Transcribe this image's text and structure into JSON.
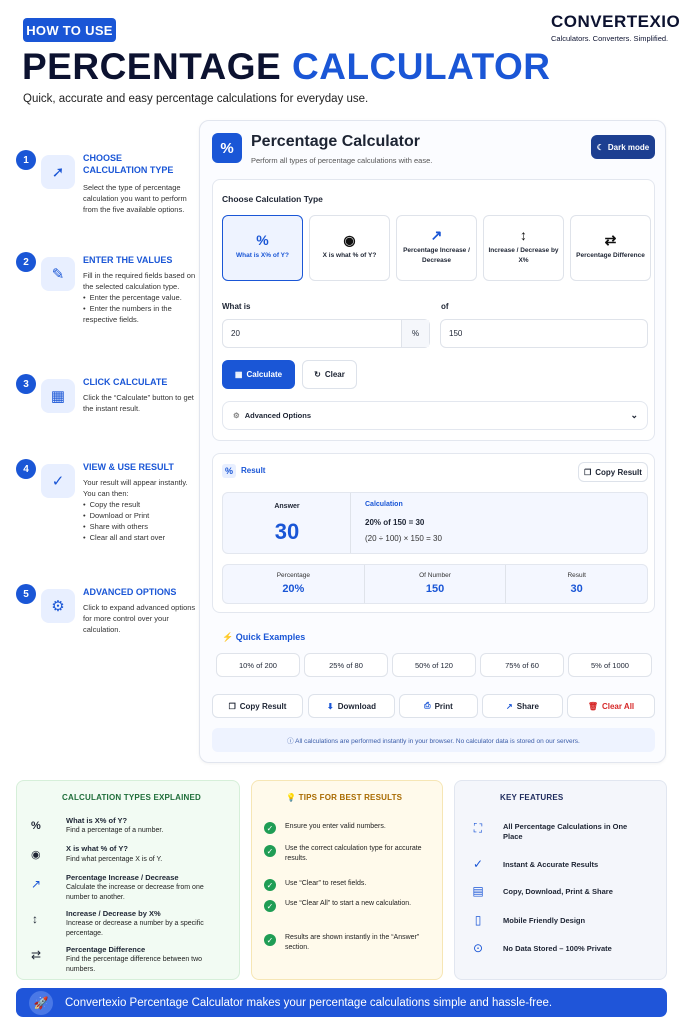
{
  "header": {
    "badge": "HOW TO USE",
    "title_main": "PERCENTAGE",
    "title_accent": "CALCULATOR",
    "subtitle": "Quick, accurate and easy percentage calculations for everyday use.",
    "brand": "CONVERTEXIO",
    "brand_tagline": "Calculators. Converters. Simplified."
  },
  "steps": [
    {
      "num": "1",
      "title_line1": "CHOOSE",
      "title_line2": "CALCULATION TYPE",
      "text": "Select the type of percentage calculation you want to perform from the five available options.",
      "bullets": []
    },
    {
      "num": "2",
      "title_line1": "ENTER THE VALUES",
      "title_line2": "",
      "text": "Fill in the required fields based on the selected calculation type.",
      "bullets": [
        "Enter the percentage value.",
        "Enter the numbers in the respective fields."
      ]
    },
    {
      "num": "3",
      "title_line1": "CLICK CALCULATE",
      "title_line2": "",
      "text": "Click the “Calculate” button to get the instant result.",
      "bullets": []
    },
    {
      "num": "4",
      "title_line1": "VIEW & USE RESULT",
      "title_line2": "",
      "text": "Your result will appear instantly. You can then:",
      "bullets": [
        "Copy the result",
        "Download or Print",
        "Share with others",
        "Clear all and start over"
      ]
    },
    {
      "num": "5",
      "title_line1": "ADVANCED OPTIONS",
      "title_line2": "",
      "text": "Click to expand advanced options for more control over your calculation.",
      "bullets": []
    }
  ],
  "calc": {
    "icon": "%",
    "title": "Percentage Calculator",
    "subtitle": "Perform all types of percentage calculations with ease.",
    "dark_mode": "Dark mode",
    "choose_label": "Choose Calculation Type",
    "types": [
      {
        "icon": "%",
        "label": "What is X% of Y?"
      },
      {
        "icon": "◉",
        "label": "X is what % of Y?"
      },
      {
        "icon": "↗",
        "label": "Percentage Increase / Decrease"
      },
      {
        "icon": "↕",
        "label": "Increase / Decrease by X%"
      },
      {
        "icon": "⇄",
        "label": "Percentage Difference"
      }
    ],
    "field1_label": "What is",
    "field1_value": "20",
    "field1_suffix": "%",
    "field2_label": "of",
    "field2_value": "150",
    "calculate": "Calculate",
    "clear": "Clear",
    "advanced": "Advanced Options",
    "result": {
      "label": "Result",
      "copy": "Copy Result",
      "answer_label": "Answer",
      "answer": "30",
      "calc_label": "Calculation",
      "calc_line1": "20% of 150 = 30",
      "calc_line2": "(20 ÷ 100) × 150 = 30",
      "cells": [
        {
          "label": "Percentage",
          "value": "20%"
        },
        {
          "label": "Of Number",
          "value": "150"
        },
        {
          "label": "Result",
          "value": "30"
        }
      ]
    },
    "examples_label": "Quick Examples",
    "examples": [
      "10% of 200",
      "25% of 80",
      "50% of 120",
      "75% of 60",
      "5% of 1000"
    ],
    "actions": {
      "copy": "Copy Result",
      "download": "Download",
      "print": "Print",
      "share": "Share",
      "clear_all": "Clear All"
    },
    "privacy": "ⓘ All calculations are performed instantly in your browser. No calculator data is stored on our servers."
  },
  "types_explained": {
    "title": "CALCULATION TYPES EXPLAINED",
    "items": [
      {
        "icon": "%",
        "title": "What is X% of Y?",
        "desc": "Find a percentage of a number."
      },
      {
        "icon": "◉",
        "title": "X is what % of Y?",
        "desc": "Find what percentage X is of Y."
      },
      {
        "icon": "↗",
        "title": "Percentage Increase / Decrease",
        "desc": "Calculate the increase or decrease from one number to another."
      },
      {
        "icon": "↕",
        "title": "Increase / Decrease by X%",
        "desc": "Increase or decrease a number by a specific percentage."
      },
      {
        "icon": "⇄",
        "title": "Percentage Difference",
        "desc": "Find the percentage difference between two numbers."
      }
    ]
  },
  "tips": {
    "title": "TIPS FOR BEST RESULTS",
    "items": [
      "Ensure you enter valid numbers.",
      "Use the correct calculation type for accurate results.",
      "Use “Clear” to reset fields.",
      "Use “Clear All” to start a new calculation.",
      "Results are shown instantly in the “Answer” section."
    ]
  },
  "features": {
    "title": "KEY FEATURES",
    "items": [
      {
        "icon": "⛶",
        "label": "All Percentage Calculations in One Place"
      },
      {
        "icon": "✓",
        "label": "Instant & Accurate Results"
      },
      {
        "icon": "▤",
        "label": "Copy, Download, Print & Share"
      },
      {
        "icon": "▯",
        "label": "Mobile Friendly Design"
      },
      {
        "icon": "⊙",
        "label": "No Data Stored – 100% Private"
      }
    ]
  },
  "footer": "Convertexio Percentage Calculator makes your percentage calculations simple and hassle-free.",
  "colors": {
    "accent": "#1a56d6",
    "green": "#1f9d55",
    "red": "#d62828"
  }
}
